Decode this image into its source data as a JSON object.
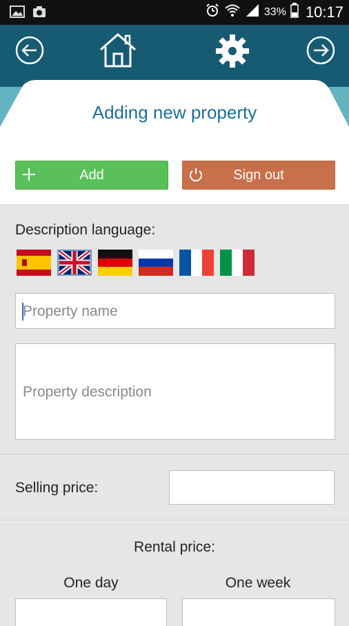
{
  "status_bar": {
    "battery_text": "33%",
    "time": "10:17"
  },
  "nav": {
    "back_icon": "arrow-left-circle-icon",
    "home_icon": "home-icon",
    "settings_icon": "gear-icon",
    "forward_icon": "arrow-right-circle-icon"
  },
  "header": {
    "title": "Adding new property"
  },
  "actions": {
    "add_label": "Add",
    "signout_label": "Sign out"
  },
  "form": {
    "description_language_label": "Description language:",
    "languages": [
      "es",
      "en",
      "de",
      "ru",
      "fr",
      "it"
    ],
    "selected_language": "en",
    "property_name_placeholder": "Property name",
    "property_description_placeholder": "Property description",
    "selling_price_label": "Selling price:",
    "rental_price_label": "Rental price:",
    "one_day_label": "One day",
    "one_week_label": "One week"
  },
  "colors": {
    "topbar": "#175b73",
    "accent": "#64b3c0",
    "title": "#1b6d9a",
    "add_button": "#5ac05a",
    "signout_button": "#c8704a"
  }
}
